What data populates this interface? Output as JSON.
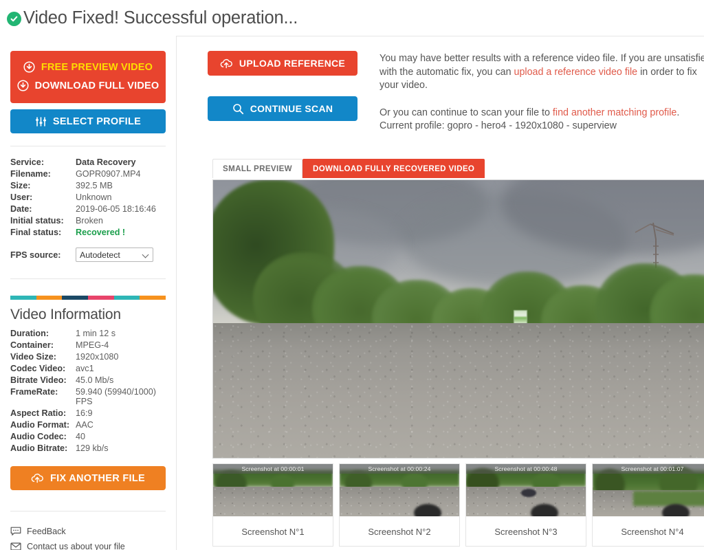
{
  "header": {
    "status_icon": "check-circle-icon",
    "title": "Video Fixed! Successful operation...",
    "accent_green": "#22b573"
  },
  "sidebar": {
    "primary_actions": {
      "preview_label": "FREE PREVIEW VIDEO",
      "preview_icon": "download-circle-icon",
      "download_label": "DOWNLOAD FULL VIDEO",
      "download_icon": "download-circle-icon",
      "select_profile_label": "SELECT PROFILE",
      "select_profile_icon": "sliders-icon",
      "red": "#e8442e",
      "blue": "#1287c8",
      "yellow": "#ffdd00"
    },
    "file_info": [
      {
        "key": "Service:",
        "value": "Data Recovery",
        "style": "bold"
      },
      {
        "key": "Filename:",
        "value": "GOPR0907.MP4",
        "style": "normal"
      },
      {
        "key": "Size:",
        "value": "392.5 MB",
        "style": "normal"
      },
      {
        "key": "User:",
        "value": "Unknown",
        "style": "normal"
      },
      {
        "key": "Date:",
        "value": "2019-06-05 18:16:46",
        "style": "normal"
      },
      {
        "key": "Initial status:",
        "value": "Broken",
        "style": "normal"
      },
      {
        "key": "Final status:",
        "value": "Recovered !",
        "style": "green"
      }
    ],
    "fps": {
      "label": "FPS source:",
      "selected": "Autodetect",
      "options": [
        "Autodetect"
      ]
    },
    "colorbar": [
      "#2eb6b6",
      "#f6921e",
      "#1b4965",
      "#e8446a",
      "#2eb6b6",
      "#f6921e"
    ],
    "video_information": {
      "title": "Video Information",
      "rows": [
        {
          "key": "Duration:",
          "value": "1 min 12 s"
        },
        {
          "key": "Container:",
          "value": "MPEG-4"
        },
        {
          "key": "Video Size:",
          "value": "1920x1080"
        },
        {
          "key": "Codec Video:",
          "value": "avc1"
        },
        {
          "key": "Bitrate Video:",
          "value": "45.0 Mb/s"
        },
        {
          "key": "FrameRate:",
          "value": "59.940 (59940/1000) FPS"
        },
        {
          "key": "Aspect Ratio:",
          "value": "16:9"
        },
        {
          "key": "Audio Format:",
          "value": "AAC"
        },
        {
          "key": "Audio Codec:",
          "value": "40"
        },
        {
          "key": "Audio Bitrate:",
          "value": "129 kb/s"
        }
      ]
    },
    "fix_another": {
      "label": "FIX ANOTHER FILE",
      "icon": "cloud-upload-icon",
      "color": "#ef8022"
    },
    "footer_links": [
      {
        "label": "FeedBack",
        "icon": "chat-bubble-icon"
      },
      {
        "label": "Contact us about your file",
        "icon": "mail-icon"
      }
    ]
  },
  "main": {
    "upload_button": {
      "label": "UPLOAD REFERENCE",
      "icon": "cloud-upload-icon",
      "color": "#e8442e"
    },
    "continue_button": {
      "label": "CONTINUE SCAN",
      "icon": "search-icon",
      "color": "#1287c8"
    },
    "paragraph_1": {
      "part1": "You may have better results with a reference video file. If you are unsatisfied with the automatic fix, you can ",
      "link": "upload a reference video file",
      "part2": " in order to fix your video."
    },
    "paragraph_2": {
      "part1": "Or you can continue to scan your file to ",
      "link": "find another matching profile",
      "part2": ". Current profile: gopro - hero4 - 1920x1080 - superview"
    },
    "tabs": [
      {
        "label": "SMALL PREVIEW",
        "active": false
      },
      {
        "label": "DOWNLOAD FULLY RECOVERED VIDEO",
        "active": true
      }
    ],
    "preview": {
      "name": "video-preview-frame",
      "description": "Park scene with trees, overcast sky and gravel path"
    },
    "thumbnails": [
      {
        "overlay": "Screenshot at 00:00:01",
        "label": "Screenshot N°1"
      },
      {
        "overlay": "Screenshot at 00:00:24",
        "label": "Screenshot N°2"
      },
      {
        "overlay": "Screenshot at 00:00:48",
        "label": "Screenshot N°3"
      },
      {
        "overlay": "Screenshot at 00:01:07",
        "label": "Screenshot N°4"
      }
    ]
  }
}
